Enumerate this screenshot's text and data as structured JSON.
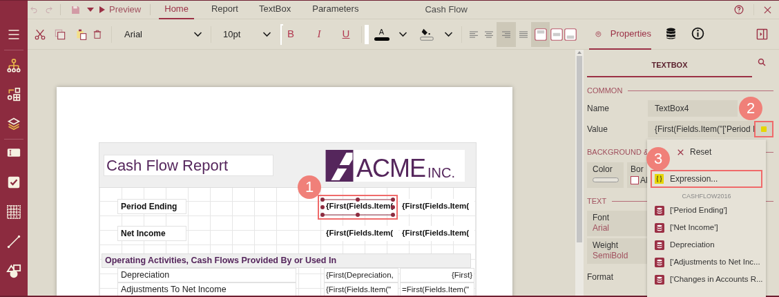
{
  "title_bar": {
    "preview": "Preview",
    "tabs": [
      {
        "label": "Home",
        "selected": true
      },
      {
        "label": "Report",
        "selected": false
      },
      {
        "label": "TextBox",
        "selected": false
      },
      {
        "label": "Parameters",
        "selected": false
      }
    ],
    "document_title": "Cash Flow"
  },
  "toolbar": {
    "font": "Arial",
    "font_size": "10pt",
    "bold": "B",
    "italic": "I",
    "underline": "U",
    "text_color_glyph": "A",
    "alignments": [
      {
        "selected": false
      },
      {
        "selected": false
      },
      {
        "selected": true
      },
      {
        "selected": false
      }
    ],
    "vertical_alignments": [
      {
        "selected": true
      },
      {
        "selected": false
      },
      {
        "selected": false
      }
    ],
    "panel_tabs": [
      {
        "kind": "properties",
        "label": "Properties",
        "selected": true
      },
      {
        "kind": "data",
        "selected": false
      },
      {
        "kind": "info",
        "selected": false
      }
    ]
  },
  "report": {
    "title": "Cash Flow Report",
    "logo_text": "ACME",
    "logo_suffix": "INC.",
    "fields": [
      {
        "label": "Period Ending",
        "values": [
          "{First(Fields.Item(",
          "{First(Fields.Item("
        ],
        "selected": true
      },
      {
        "label": "Net Income",
        "values": [
          "{First(Fields.Item(",
          "{First(Fields.Item("
        ],
        "selected": false
      }
    ],
    "section": "Operating Activities, Cash Flows Provided By or Used In",
    "rows": [
      {
        "label": "Depreciation",
        "values": [
          "{First(Depreciation,",
          "{First}"
        ]
      },
      {
        "label": "Adjustments To Net Income",
        "values": [
          "{First(Fields.Item(\"",
          "=First(Fields.Item(\""
        ]
      }
    ]
  },
  "properties": {
    "heading": "TEXTBOX",
    "common": {
      "title": "COMMON",
      "rows": [
        {
          "label": "Name",
          "value": "TextBox4"
        },
        {
          "label": "Value",
          "value": "{First(Fields.Item(\"['Period I"
        }
      ]
    },
    "background": {
      "title": "BACKGROUND &",
      "color_label": "Color",
      "border_label": "Bor",
      "border_check_label": "Al",
      "border_checked": false
    },
    "text": {
      "title": "TEXT",
      "cells": [
        {
          "label": "Font",
          "value": "Arial"
        },
        {
          "label": "Weight",
          "value": "SemiBold"
        }
      ]
    },
    "format_label": "Format"
  },
  "menu": {
    "items": [
      {
        "kind": "reset",
        "label": "Reset",
        "highlighted": false
      },
      {
        "kind": "expression",
        "label": "Expression...",
        "highlighted": true
      }
    ],
    "group": "CASHFLOW2016",
    "fields": [
      "['Period Ending']",
      "['Net Income']",
      "Depreciation",
      "['Adjustments to Net Inc...",
      "['Changes in Accounts R..."
    ]
  },
  "callouts": [
    "1",
    "2",
    "3"
  ]
}
